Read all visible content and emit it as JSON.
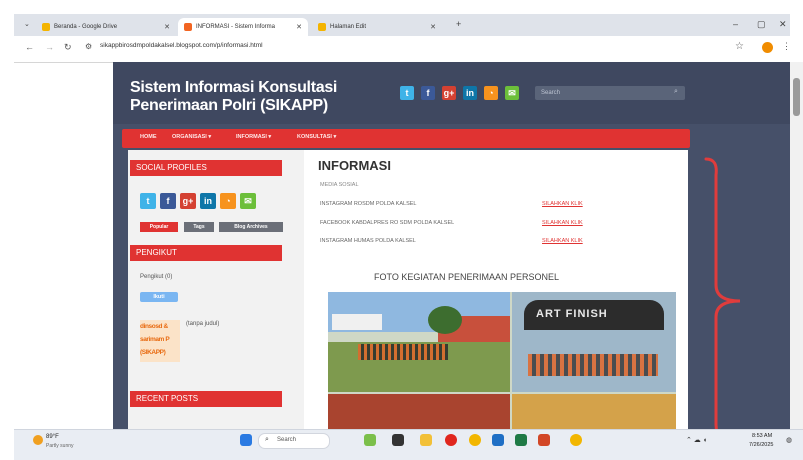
{
  "browser": {
    "tabs": [
      {
        "label": "Beranda - Google Drive",
        "color": "#f4b400"
      },
      {
        "label": "INFORMASI - Sistem Informa",
        "color": "#f26522"
      },
      {
        "label": "Halaman Edit",
        "color": "#f4b400"
      }
    ],
    "new_tab": "+",
    "url": "sikappbirosdmpoldakalsel.blogspot.com/p/informasi.html"
  },
  "site": {
    "title_line1": "Sistem Informasi Konsultasi",
    "title_line2": "Penerimaan Polri (SIKAPP)",
    "search_placeholder": "Search",
    "social_icons": [
      {
        "name": "twitter-icon",
        "glyph": "t",
        "color": "#3fb3e8"
      },
      {
        "name": "facebook-icon",
        "glyph": "f",
        "color": "#3b5998"
      },
      {
        "name": "google-plus-icon",
        "glyph": "g+",
        "color": "#d44132"
      },
      {
        "name": "linkedin-icon",
        "glyph": "in",
        "color": "#0e76a8"
      },
      {
        "name": "rss-icon",
        "glyph": "◔",
        "color": "#f7931e"
      },
      {
        "name": "email-icon",
        "glyph": "✉",
        "color": "#6cbf3a"
      }
    ]
  },
  "nav": [
    "HOME",
    "ORGANISASI ▾",
    "INFORMASI ▾",
    "KONSULTASI ▾"
  ],
  "sidebar": {
    "social_profiles": "SOCIAL PROFILES",
    "tabs": [
      "Popular",
      "Tags",
      "Blog Archives"
    ],
    "pengikut_heading": "PENGIKUT",
    "pengikut_count": "Pengikut (0)",
    "follow_button": "Ikuti",
    "banner_lines": [
      "dinsosd &",
      "sarimam P",
      "(SIKAPP)"
    ],
    "banner_caption": "(tanpa judul)",
    "recent_posts": "RECENT POSTS"
  },
  "main": {
    "title": "INFORMASI",
    "subtitle": "MEDIA SOSIAL",
    "rows": [
      {
        "label": "INSTAGRAM ROSDM POLDA KALSEL",
        "link": "SILAHKAN KLIK"
      },
      {
        "label": "FACEBOOK KABDALPRES RO SDM POLDA KALSEL",
        "link": "SILAHKAN KLIK"
      },
      {
        "label": "INSTAGRAM HUMAS POLDA KALSEL",
        "link": "SILAHKAN KLIK"
      }
    ],
    "photo_heading": "FOTO KEGIATAN PENERIMAAN PERSONEL",
    "photo_banner": "ART FINISH"
  },
  "taskbar": {
    "weather_temp": "89°F",
    "weather_desc": "Partly sunny",
    "search": "Search",
    "time": "8:53 AM",
    "date": "7/26/2025"
  },
  "colors": {
    "accent": "#e03332",
    "header_bg": "#3f4860",
    "annotation": "#e03c3c"
  }
}
